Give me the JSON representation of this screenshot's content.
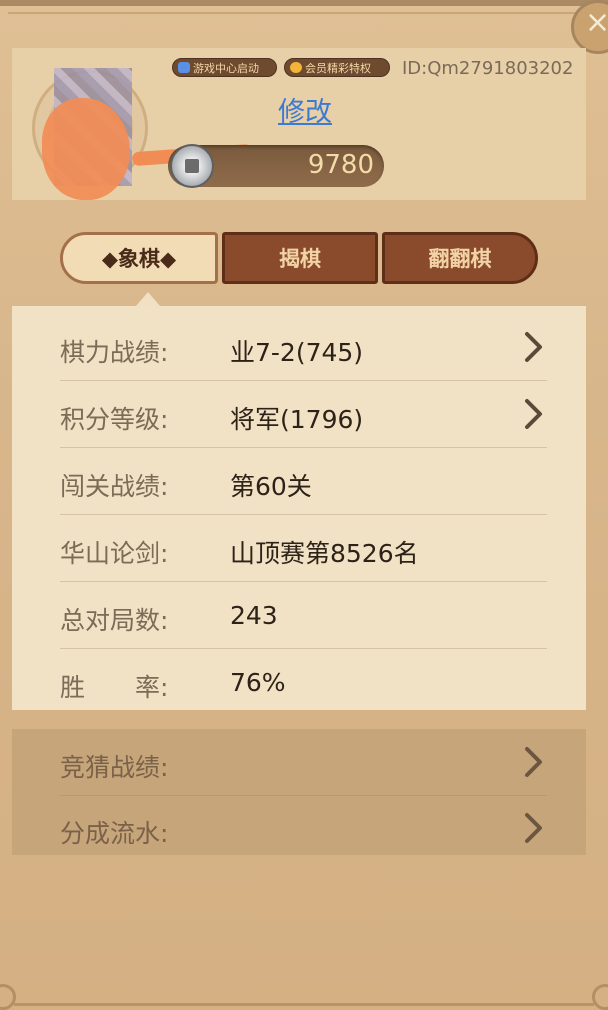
{
  "profile": {
    "badges": [
      "游戏中心启动",
      "会员精彩特权"
    ],
    "user_id": "ID:Qm2791803202",
    "edit_label": "修改",
    "coin_amount": "9780"
  },
  "tabs": [
    {
      "label": "◆象棋◆",
      "active": true
    },
    {
      "label": "揭棋",
      "active": false
    },
    {
      "label": "翻翻棋",
      "active": false
    }
  ],
  "stats": [
    {
      "label": "棋力战绩:",
      "value": "业7-2(745)",
      "has_arrow": true
    },
    {
      "label": "积分等级:",
      "value": "将军(1796)",
      "has_arrow": true
    },
    {
      "label": "闯关战绩:",
      "value": "第60关",
      "has_arrow": false
    },
    {
      "label": "华山论剑:",
      "value": "山顶赛第8526名",
      "has_arrow": false
    },
    {
      "label": "总对局数:",
      "value": "243",
      "has_arrow": false
    },
    {
      "label": "胜　　率:",
      "value": "76%",
      "has_arrow": false
    }
  ],
  "extra": [
    {
      "label": "竞猜战绩:",
      "has_arrow": true
    },
    {
      "label": "分成流水:",
      "has_arrow": true
    }
  ],
  "colors": {
    "panel_bg": "#d7b58a",
    "stats_bg": "#f1e1c5",
    "tab_inactive": "#8a4a2c",
    "edit_link": "#3b7bd4"
  },
  "icons": [
    "close-icon",
    "gamepad-icon",
    "vip-icon",
    "coin-icon",
    "chevron-right-icon"
  ]
}
